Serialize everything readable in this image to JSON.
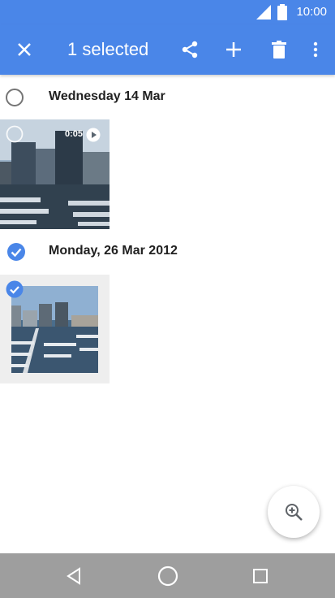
{
  "status_bar": {
    "time": "10:00"
  },
  "app_bar": {
    "title": "1 selected"
  },
  "sections": [
    {
      "date": "Wednesday 14 Mar",
      "selected": false,
      "items": [
        {
          "type": "video",
          "duration": "0:05",
          "selected": false
        }
      ]
    },
    {
      "date": "Monday, 26 Mar 2012",
      "selected": true,
      "items": [
        {
          "type": "photo",
          "selected": true
        }
      ]
    }
  ],
  "icons": {
    "close": "close-icon",
    "share": "share-icon",
    "add": "plus-icon",
    "delete": "trash-icon",
    "more": "more-vert-icon",
    "zoom": "zoom-in-icon",
    "back": "back-icon",
    "home": "home-icon",
    "recents": "recents-icon"
  },
  "colors": {
    "accent": "#4a86e8",
    "nav_bar": "#9e9e9e"
  }
}
